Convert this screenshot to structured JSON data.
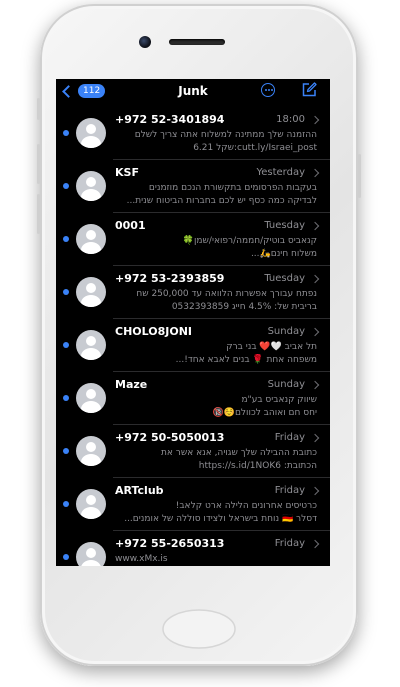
{
  "navbar": {
    "back_count": "112",
    "title": "Junk"
  },
  "icons": {
    "back": "chevron-left-icon",
    "more": "ellipsis-circle-icon",
    "compose": "compose-icon",
    "avatar": "person-icon",
    "row_disclosure": "chevron-right-icon",
    "unread": "unread-dot-icon"
  },
  "colors": {
    "accent": "#3a82f7",
    "screen_bg": "#000000",
    "secondary_text": "#8e8e93",
    "avatar_bg": "#c8cbd1"
  },
  "messages": [
    {
      "sender": "+972 52-3401894",
      "time": "18:00",
      "line1": "ההזמנה שלך ממתינה למשלוח אתה צריך לשלם",
      "line2": "cutt.ly/Israei_post:שקל 6.21"
    },
    {
      "sender": "KSF",
      "time": "Yesterday",
      "line1": "בעקבות הפרסומים בתקשורת הנכם מוזמנים",
      "line2": "לבדיקה כמה כסף יש לכם בחברות הביטוח שנית..."
    },
    {
      "sender": "0001",
      "time": "Tuesday",
      "line1": "קנאביס בוטיק/חממה/רפואי/שמן🍀",
      "line2": "משלוח חינם🛵..."
    },
    {
      "sender": "+972 53-2393859",
      "time": "Tuesday",
      "line1": "נפתח עבורך אפשרות הלוואה עד 250,000 שח",
      "line2": "בריבית של: 4.5% חייג 0532393859"
    },
    {
      "sender": "CHOLO8JONI",
      "time": "Sunday",
      "line1": "תל אביב 🤍❤️ בני ברק",
      "line2": "משפחה אחת 🌹 בנים לאבא אחד!..."
    },
    {
      "sender": "Maze",
      "time": "Sunday",
      "line1": "שיווק קנאביס בע\"מ",
      "line2": "יחס חם ואוהב לכוולם☺️🔞"
    },
    {
      "sender": "+972 50-5050013",
      "time": "Friday",
      "line1": "כתובת ההבילה שלך שגויה, אנא אשר את",
      "line2": "הכתובת: https://s.id/1NOK6"
    },
    {
      "sender": "ARTclub",
      "time": "Friday",
      "line1": "כרטיסים אחרונים הלילה ארט קלאב!",
      "line2": "דסלר 🇩🇪 נוחת בישראל ולצידו סוללה של אומנים..."
    },
    {
      "sender": "+972 55-2650313",
      "time": "Friday",
      "line1": "www.xMx.is",
      "line2": ""
    }
  ]
}
